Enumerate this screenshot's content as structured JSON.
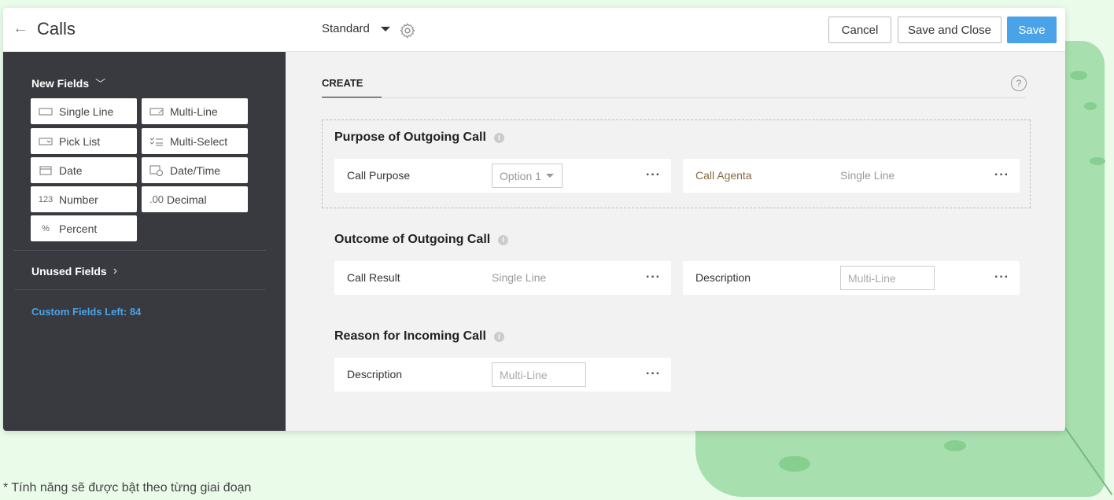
{
  "header": {
    "title": "Calls",
    "layout_name": "Standard",
    "cancel_label": "Cancel",
    "save_close_label": "Save and Close",
    "save_label": "Save"
  },
  "sidebar": {
    "new_fields_heading": "New Fields",
    "tiles": [
      {
        "label": "Single Line",
        "icon": "single-line-icon"
      },
      {
        "label": "Multi-Line",
        "icon": "multi-line-icon"
      },
      {
        "label": "Pick List",
        "icon": "pick-list-icon"
      },
      {
        "label": "Multi-Select",
        "icon": "multi-select-icon"
      },
      {
        "label": "Date",
        "icon": "calendar-icon"
      },
      {
        "label": "Date/Time",
        "icon": "calendar-clock-icon"
      },
      {
        "label": "Number",
        "icon": "number-icon",
        "icon_text": "123"
      },
      {
        "label": "Decimal",
        "icon": "decimal-icon",
        "icon_text": ".00"
      },
      {
        "label": "Percent",
        "icon": "percent-icon"
      }
    ],
    "unused_fields_heading": "Unused Fields",
    "custom_fields_left": "Custom Fields Left: 84"
  },
  "main": {
    "tab_label": "CREATE",
    "sections": [
      {
        "title": "Purpose of Outgoing Call",
        "fields": [
          {
            "label": "Call Purpose",
            "type_display": "Option 1"
          },
          {
            "label": "Call Agenta",
            "type_display": "Single Line"
          }
        ]
      },
      {
        "title": "Outcome of Outgoing Call",
        "fields": [
          {
            "label": "Call Result",
            "type_display": "Single Line"
          },
          {
            "label": "Description",
            "type_display": "Multi-Line"
          }
        ]
      },
      {
        "title": "Reason for Incoming Call",
        "fields": [
          {
            "label": "Description",
            "type_display": "Multi-Line"
          }
        ]
      }
    ]
  },
  "footnote": "* Tính năng sẽ được bật theo từng giai đoạn",
  "colors": {
    "accent": "#4aa3e8",
    "sidebar_bg": "#383a40",
    "highlight_label": "#8a6a3f"
  }
}
